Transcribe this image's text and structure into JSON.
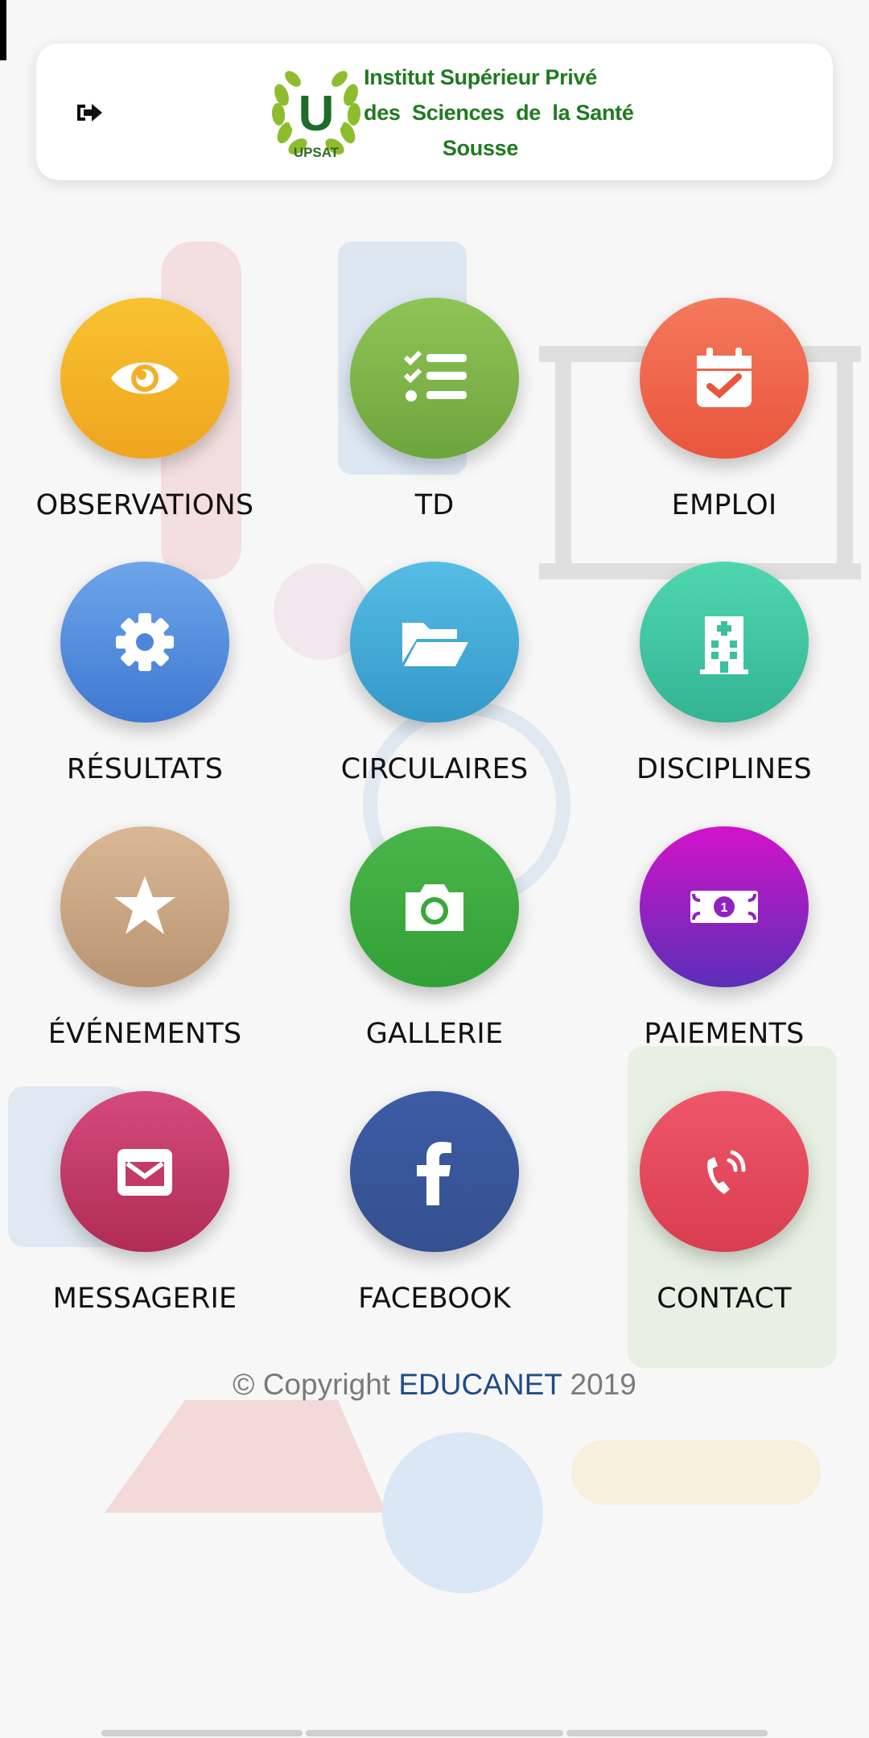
{
  "header": {
    "logout_icon": "sign-out-icon",
    "logo_text": "UPSAT",
    "logo_letter": "U",
    "institution_line1": "Institut Supérieur Privé",
    "institution_line2": "des  Sciences  de  la Santé",
    "institution_line3": "Sousse"
  },
  "tiles": [
    {
      "label": "OBSERVATIONS",
      "icon": "eye-icon",
      "color_top": "#f8c230",
      "color_bottom": "#efa51f"
    },
    {
      "label": "TD",
      "icon": "checklist-icon",
      "color_top": "#8fc456",
      "color_bottom": "#6ea43d"
    },
    {
      "label": "EMPLOI",
      "icon": "calendar-check-icon",
      "color_top": "#f4795d",
      "color_bottom": "#e9553d"
    },
    {
      "label": "RÉSULTATS",
      "icon": "gear-icon",
      "color_top": "#6ea6ea",
      "color_bottom": "#3f78d1"
    },
    {
      "label": "CIRCULAIRES",
      "icon": "folder-open-icon",
      "color_top": "#56bde6",
      "color_bottom": "#3498c7"
    },
    {
      "label": "DISCIPLINES",
      "icon": "hospital-icon",
      "color_top": "#4fd6b0",
      "color_bottom": "#33b494"
    },
    {
      "label": "ÉVÉNEMENTS",
      "icon": "star-icon",
      "color_top": "#dab895",
      "color_bottom": "#b99472"
    },
    {
      "label": "GALLERIE",
      "icon": "camera-icon",
      "color_top": "#48b64a",
      "color_bottom": "#32a036"
    },
    {
      "label": "PAIEMENTS",
      "icon": "money-bill-icon",
      "color_top": "#d313c9",
      "color_bottom": "#5a2fb8"
    },
    {
      "label": "MESSAGERIE",
      "icon": "envelope-icon",
      "color_top": "#d54a7c",
      "color_bottom": "#b02c55"
    },
    {
      "label": "FACEBOOK",
      "icon": "facebook-icon",
      "color_top": "#3d5ca5",
      "color_bottom": "#34508f"
    },
    {
      "label": "CONTACT",
      "icon": "phone-ringing-icon",
      "color_top": "#f0566a",
      "color_bottom": "#d83e4f"
    }
  ],
  "footer": {
    "prefix": "© Copyright ",
    "brand": "EDUCANET",
    "year": " 2019"
  }
}
